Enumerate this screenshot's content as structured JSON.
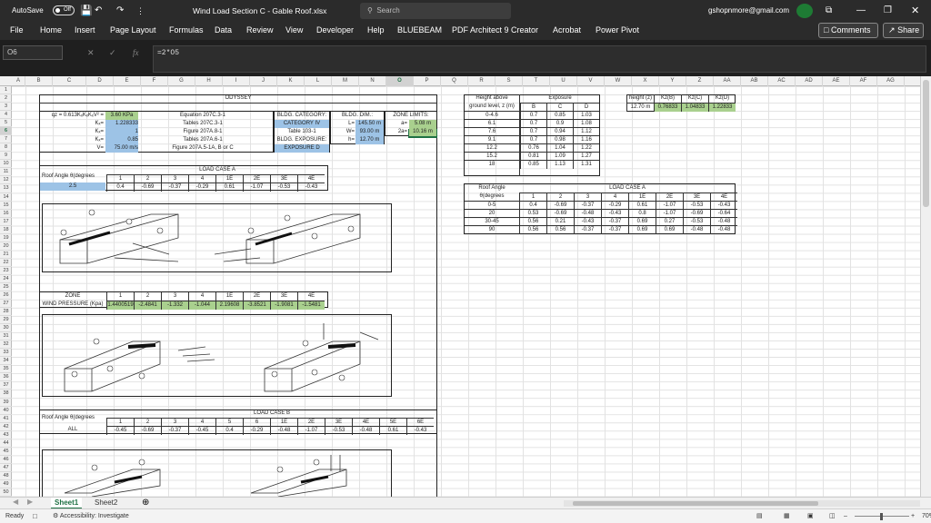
{
  "titlebar": {
    "autosave": "AutoSave",
    "autosave_state": "Off",
    "file_title": "Wind Load Section C - Gable Roof.xlsx",
    "search_placeholder": "Search",
    "user_email": "gshopnmore@gmail.com"
  },
  "ribbon": {
    "tabs": [
      "File",
      "Home",
      "Insert",
      "Page Layout",
      "Formulas",
      "Data",
      "Review",
      "View",
      "Developer",
      "Help",
      "BLUEBEAM",
      "PDF Architect 9 Creator",
      "Acrobat",
      "Power Pivot"
    ],
    "comments": "Comments",
    "share": "Share"
  },
  "formula_bar": {
    "name_box": "O6",
    "formula": "=2*O5"
  },
  "columns": [
    "A",
    "B",
    "C",
    "D",
    "E",
    "F",
    "G",
    "H",
    "I",
    "J",
    "K",
    "L",
    "M",
    "N",
    "O",
    "P",
    "Q",
    "R",
    "S",
    "T",
    "U",
    "V",
    "W",
    "X",
    "Y",
    "Z",
    "AA",
    "AB",
    "AC",
    "AD",
    "AE",
    "AF",
    "AG"
  ],
  "rows": [
    "1",
    "2",
    "3",
    "4",
    "5",
    "6",
    "7",
    "8",
    "9",
    "10",
    "11",
    "12",
    "13",
    "14",
    "15",
    "16",
    "17",
    "18",
    "19",
    "20",
    "21",
    "22",
    "23",
    "24",
    "25",
    "26",
    "27",
    "28",
    "29",
    "30",
    "31",
    "32",
    "33",
    "34",
    "35",
    "36",
    "37",
    "38",
    "39",
    "40",
    "41",
    "42",
    "43",
    "44",
    "45",
    "46",
    "47",
    "48",
    "49",
    "50"
  ],
  "sheet": {
    "title": "ODYSSEY",
    "qz_label": "qz = 0.613KₓKₓKₓV² =",
    "qz_value": "3.60 KPa",
    "qz_ref": "Equation 207C.3-1",
    "params": [
      {
        "label": "Kₓ=",
        "value": "1.228333",
        "ref": "Tables 207C.3-1"
      },
      {
        "label": "Kₓ=",
        "value": "1",
        "ref": "Figure 207A.8-1"
      },
      {
        "label": "Kₓ=",
        "value": "0.85",
        "ref": "Tables 207A.6-1"
      },
      {
        "label": "V=",
        "value": "75.00 m/s",
        "ref": "Figure 207A.5-1A, B or C"
      }
    ],
    "bldg_category_label": "BLDG. CATEGORY:",
    "bldg_category": "CATEGORY IV",
    "bldg_table": "Table 103-1",
    "bldg_exposure_label": "BLDG. EXPOSURE:",
    "bldg_exposure": "EXPOSURE D",
    "dim_label": "BLDG. DIM.:",
    "dims": [
      {
        "label": "L=",
        "value": "145.50 m"
      },
      {
        "label": "W=",
        "value": "93.00 m"
      },
      {
        "label": "h=",
        "value": "12.70 m"
      }
    ],
    "zone_label": "ZONE LIMITS:",
    "zones": [
      {
        "label": "a=",
        "value": "5.08 m"
      },
      {
        "label": "2a=",
        "value": "10.16 m"
      }
    ],
    "lca": {
      "title": "LOAD CASE A",
      "angle_label": "Roof Angle θ(degrees",
      "angle": "2.5",
      "headers": [
        "1",
        "2",
        "3",
        "4",
        "1E",
        "2E",
        "3E",
        "4E"
      ],
      "values": [
        "0.4",
        "-0.69",
        "-0.37",
        "-0.29",
        "0.61",
        "-1.07",
        "-0.53",
        "-0.43"
      ]
    },
    "wind": {
      "zone_label": "ZONE",
      "pressure_label": "WIND PRESSURE (Kpa)",
      "zones": [
        "1",
        "2",
        "3",
        "4",
        "1E",
        "2E",
        "3E",
        "4E"
      ],
      "values": [
        "1.4400519",
        "-2.4841",
        "-1.332",
        "-1.044",
        "2.19608",
        "-3.8521",
        "-1.9081",
        "-1.5481"
      ]
    },
    "lcb": {
      "title": "LOAD CASE B",
      "angle_label": "Roof Angle θ(degrees",
      "row_label": "ALL",
      "headers": [
        "1",
        "2",
        "3",
        "4",
        "5",
        "6",
        "1E",
        "2E",
        "3E",
        "4E",
        "5E",
        "6E"
      ],
      "values": [
        "-0.45",
        "-0.69",
        "-0.37",
        "-0.45",
        "0.4",
        "-0.29",
        "-0.48",
        "-1.07",
        "-0.53",
        "-0.48",
        "0.61",
        "-0.43"
      ]
    },
    "exposure_table": {
      "h1": "Height above",
      "h2": "ground level, z (m)",
      "title": "Exposure",
      "cols": [
        "B",
        "C",
        "D"
      ],
      "rows": [
        [
          "0-4.6",
          "0.7",
          "0.85",
          "1.03"
        ],
        [
          "6.1",
          "0.7",
          "0.9",
          "1.08"
        ],
        [
          "7.6",
          "0.7",
          "0.94",
          "1.12"
        ],
        [
          "9.1",
          "0.7",
          "0.98",
          "1.16"
        ],
        [
          "12.2",
          "0.76",
          "1.04",
          "1.22"
        ],
        [
          "15.2",
          "0.81",
          "1.09",
          "1.27"
        ],
        [
          "18",
          "0.85",
          "1.13",
          "1.31"
        ]
      ]
    },
    "kz_table": {
      "headers": [
        "height (z)",
        "Kz(B)",
        "Kz(C)",
        "Kz(D)"
      ],
      "values": [
        "12.70 m",
        "0.76833",
        "1.04833",
        "1.22833"
      ]
    },
    "lca2": {
      "title": "LOAD CASE A",
      "angle_label1": "Roof Angle",
      "angle_label2": "θ(degrees",
      "headers": [
        "1",
        "2",
        "3",
        "4",
        "1E",
        "2E",
        "3E",
        "4E"
      ],
      "rows": [
        [
          "0-5",
          "0.4",
          "-0.69",
          "-0.37",
          "-0.29",
          "0.61",
          "-1.07",
          "-0.53",
          "-0.43"
        ],
        [
          "20",
          "0.53",
          "-0.69",
          "-0.48",
          "-0.43",
          "0.8",
          "-1.07",
          "-0.69",
          "-0.64"
        ],
        [
          "30-45",
          "0.56",
          "0.21",
          "-0.43",
          "-0.37",
          "0.69",
          "0.27",
          "-0.53",
          "-0.48"
        ],
        [
          "90",
          "0.56",
          "0.56",
          "-0.37",
          "-0.37",
          "0.69",
          "0.69",
          "-0.48",
          "-0.48"
        ]
      ]
    }
  },
  "sheets": [
    "Sheet1",
    "Sheet2"
  ],
  "status": {
    "ready": "Ready",
    "accessibility": "Accessibility: Investigate",
    "zoom": "70%"
  }
}
